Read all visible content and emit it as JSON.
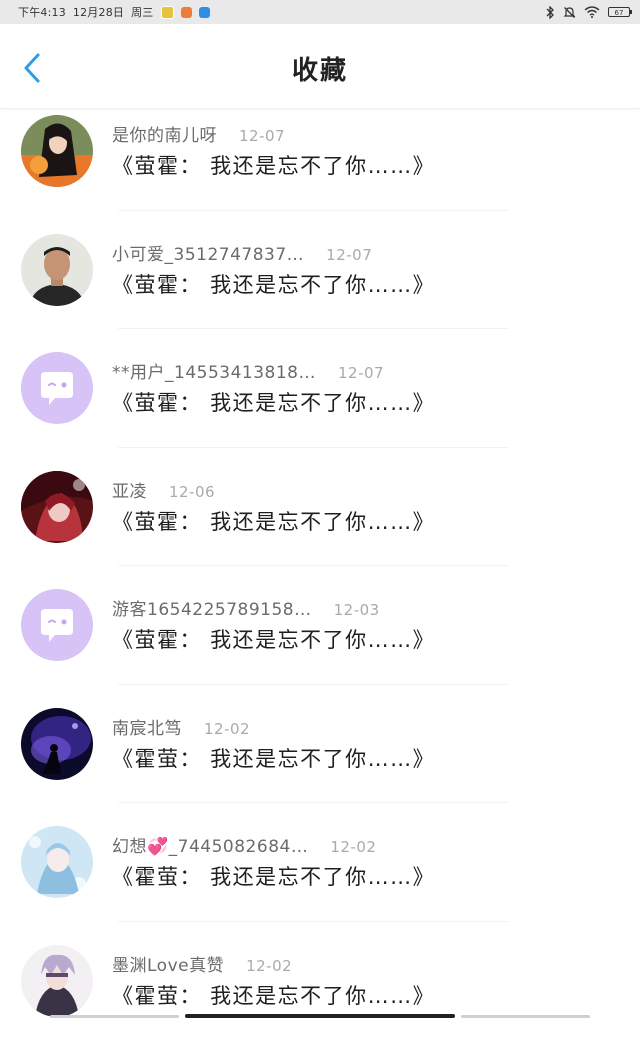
{
  "status_bar": {
    "time": "下午4:13",
    "date": "12月28日",
    "weekday": "周三",
    "battery": "67"
  },
  "header": {
    "title": "收藏",
    "back_icon": "chevron-left-icon",
    "accent": "#2f9be9"
  },
  "list": [
    {
      "username": "是你的南儿呀",
      "date": "12-07",
      "content": "《萤霍： 我还是忘不了你……》",
      "avatar": "photo-girl"
    },
    {
      "username": "小可爱_3512747837…",
      "date": "12-07",
      "content": "《萤霍： 我还是忘不了你……》",
      "avatar": "photo-man"
    },
    {
      "username": "**用户_14553413818…",
      "date": "12-07",
      "content": "《萤霍： 我还是忘不了你……》",
      "avatar": "default-chat"
    },
    {
      "username": "亚凌",
      "date": "12-06",
      "content": "《萤霍： 我还是忘不了你……》",
      "avatar": "photo-red-art"
    },
    {
      "username": "游客1654225789158…",
      "date": "12-03",
      "content": "《萤霍： 我还是忘不了你……》",
      "avatar": "default-chat"
    },
    {
      "username": "南宸北笃",
      "date": "12-02",
      "content": "《霍萤： 我还是忘不了你……》",
      "avatar": "photo-purple-art"
    },
    {
      "username": "幻想💞_7445082684…",
      "date": "12-02",
      "content": "《霍萤： 我还是忘不了你……》",
      "avatar": "photo-blue-art"
    },
    {
      "username": "墨渊Love真赞",
      "date": "12-02",
      "content": "《霍萤： 我还是忘不了你……》",
      "avatar": "photo-anime-boy"
    }
  ]
}
